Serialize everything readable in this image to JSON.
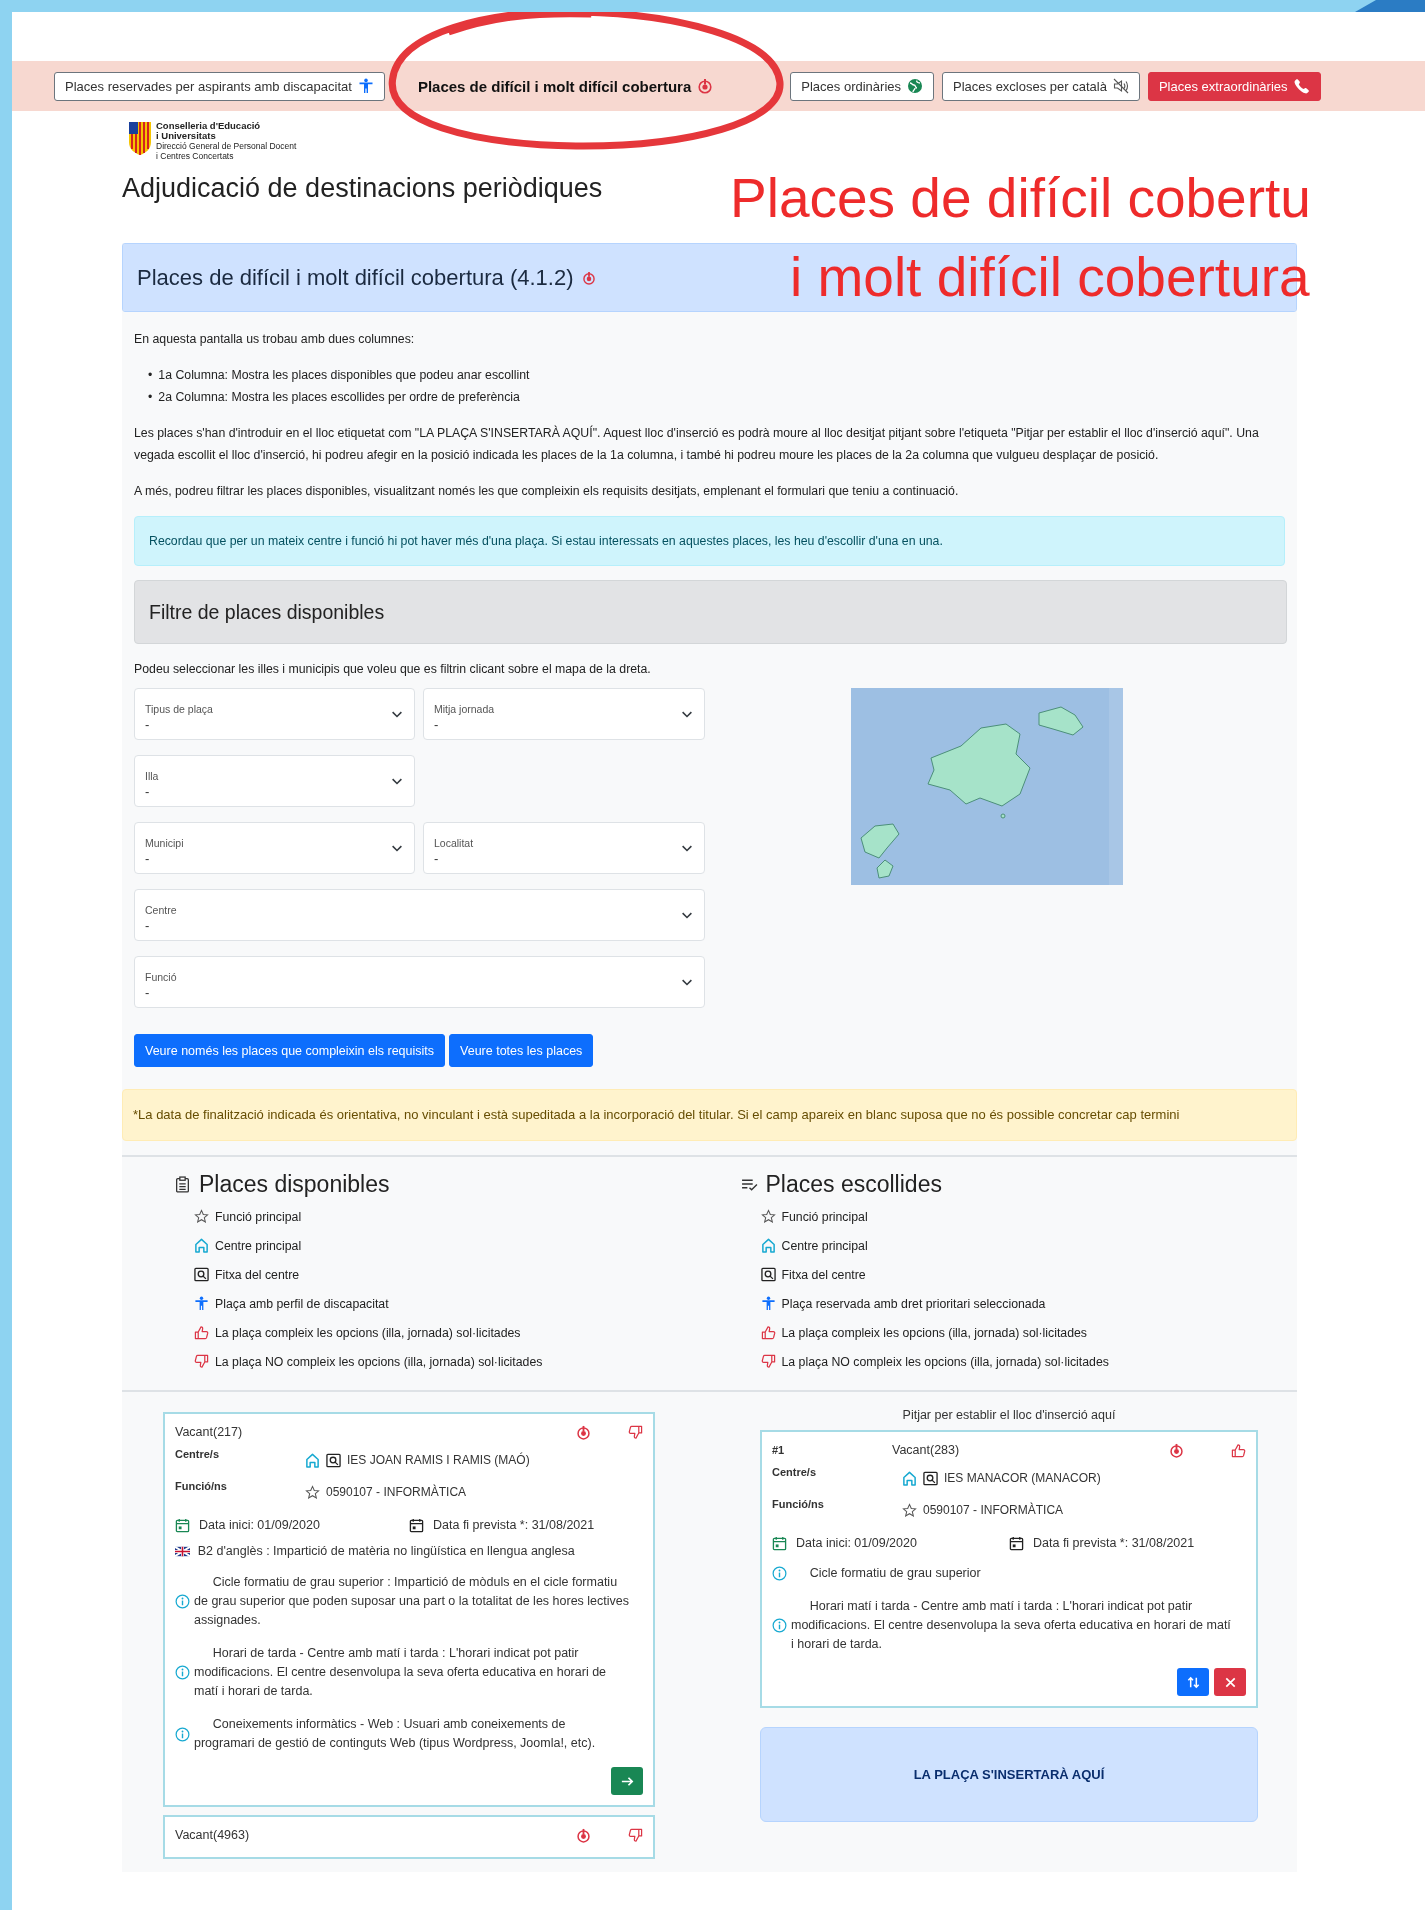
{
  "tabs": [
    {
      "label": "Places reservades per aspirants amb discapacitat",
      "kind": "outline",
      "selected": false
    },
    {
      "label": "Places de difícil i molt difícil cobertura",
      "kind": "outline",
      "selected": true
    },
    {
      "label": "Places ordinàries",
      "kind": "outline",
      "selected": false
    },
    {
      "label": "Places excloses per català",
      "kind": "outline",
      "selected": false
    },
    {
      "label": "Places extraordinàries",
      "kind": "danger",
      "selected": false
    }
  ],
  "annotation": {
    "lines": [
      "Places de difícil cobertu",
      "i molt difícil cobertura"
    ]
  },
  "logo": {
    "lines": [
      "Conselleria d'Educació",
      "i Universitats",
      "Direcció General de Personal Docent",
      "i Centres Concertats"
    ]
  },
  "page_title": "Adjudicació de destinacions periòdiques",
  "panel_title": "Places de difícil i molt difícil cobertura (4.1.2)",
  "intro": {
    "lead": "En aquesta pantalla us trobau amb dues columnes:",
    "bullets": [
      {
        "marker": "•",
        "text": "1a Columna: Mostra les places disponibles que podeu anar escollint"
      },
      {
        "marker": "•",
        "text": "2a Columna: Mostra les places escollides per ordre de preferència"
      }
    ],
    "paragraphs": [
      "Les places s'han d'introduir en el lloc etiquetat com \"LA PLAÇA S'INSERTARÀ AQUÍ\". Aquest lloc d'inserció es podrà moure al lloc desitjat pitjant sobre l'etiqueta \"Pitjar per establir el lloc d'inserció aquí\". Una vegada escollit el lloc d'inserció, hi podreu afegir en la posició indicada les places de la 1a columna, i també hi podreu moure les places de la 2a columna que vulgueu desplaçar de posició.",
      "A més, podreu filtrar les places disponibles, visualitzant només les que compleixin els requisits desitjats, emplenant el formulari que teniu a continuació."
    ]
  },
  "info_alert": "Recordau que per un mateix centre i funció hi pot haver més d'una plaça. Si estau interessats en aquestes places, les heu d'escollir d'una en una.",
  "filter": {
    "title": "Filtre de places disponibles",
    "hint": "Podeu seleccionar les illes i municipis que voleu que es filtrin clicant sobre el mapa de la dreta.",
    "selects": [
      {
        "label": "Tipus de plaça",
        "value": "-",
        "wide": false
      },
      {
        "label": "Mitja jornada",
        "value": "-",
        "wide": false
      },
      {
        "label": "Illa",
        "value": "-",
        "wide": false
      },
      {
        "label": "Municipi",
        "value": "-",
        "wide": false
      },
      {
        "label": "Localitat",
        "value": "-",
        "wide": false
      },
      {
        "label": "Centre",
        "value": "-",
        "wide": true
      },
      {
        "label": "Funció",
        "value": "-",
        "wide": true
      }
    ],
    "buttons": [
      "Veure només les places que compleixin els requisits",
      "Veure totes les places"
    ]
  },
  "warning": "*La data de finalització indicada és orientativa, no vinculant i està supeditada a la incorporació del titular. Si el camp apareix en blanc suposa que no és possible concretar cap termini",
  "legends": [
    {
      "title": "Places disponibles",
      "items": [
        "Funció principal",
        "Centre principal",
        "Fitxa del centre",
        "Plaça amb perfil de discapacitat",
        "La plaça compleix les opcions (illa, jornada) sol·licitades",
        "La plaça NO compleix les opcions (illa, jornada) sol·licitades"
      ]
    },
    {
      "title": "Places escollides",
      "items": [
        "Funció principal",
        "Centre principal",
        "Fitxa del centre",
        "Plaça reservada amb dret prioritari seleccionada",
        "La plaça compleix les opcions (illa, jornada) sol·licitades",
        "La plaça NO compleix les opcions (illa, jornada) sol·licitades"
      ]
    }
  ],
  "available_places": [
    {
      "title": "Vacant(217)",
      "matches": false,
      "centre_label": "Centre/s",
      "centre": "IES JOAN RAMIS I RAMIS (MAÓ)",
      "function_label": "Funció/ns",
      "function": "0590107 - INFORMÀTICA",
      "start": "Data inici: 01/09/2020",
      "end": "Data fi prevista *: 31/08/2021",
      "notes": [
        {
          "kind": "flag",
          "text": "B2 d'anglès : Impartició de matèria no lingüística en llengua anglesa"
        },
        {
          "kind": "info",
          "text": "Cicle formatiu de grau superior : Impartició de mòduls en el cicle formatiu de grau superior que poden suposar una part o la totalitat de les hores lectives assignades."
        },
        {
          "kind": "info",
          "text": "Horari de tarda - Centre amb matí i tarda : L'horari indicat pot patir modificacions. El centre desenvolupa la seva oferta educativa en horari de matí i horari de tarda."
        },
        {
          "kind": "info",
          "text": "Coneixements informàtics - Web : Usuari amb coneixements de programari de gestió de continguts Web (tipus Wordpress, Joomla!, etc)."
        }
      ]
    },
    {
      "title": "Vacant(4963)",
      "matches": false
    }
  ],
  "chosen_places": {
    "insert_link": "Pitjar per establir el lloc d'inserció aquí",
    "places": [
      {
        "number": "#1",
        "title": "Vacant(283)",
        "matches": true,
        "centre_label": "Centre/s",
        "centre": "IES MANACOR (MANACOR)",
        "function_label": "Funció/ns",
        "function": "0590107 - INFORMÀTICA",
        "start": "Data inici: 01/09/2020",
        "end": "Data fi prevista *: 31/08/2021",
        "notes": [
          {
            "kind": "info",
            "text": "Cicle formatiu de grau superior"
          },
          {
            "kind": "info",
            "text": "Horari matí i tarda - Centre amb matí i tarda : L'horari indicat pot patir modificacions. El centre desenvolupa la seva oferta educativa en horari de matí i horari de tarda."
          }
        ]
      }
    ],
    "insert_label": "LA PLAÇA S'INSERTARÀ AQUÍ"
  }
}
